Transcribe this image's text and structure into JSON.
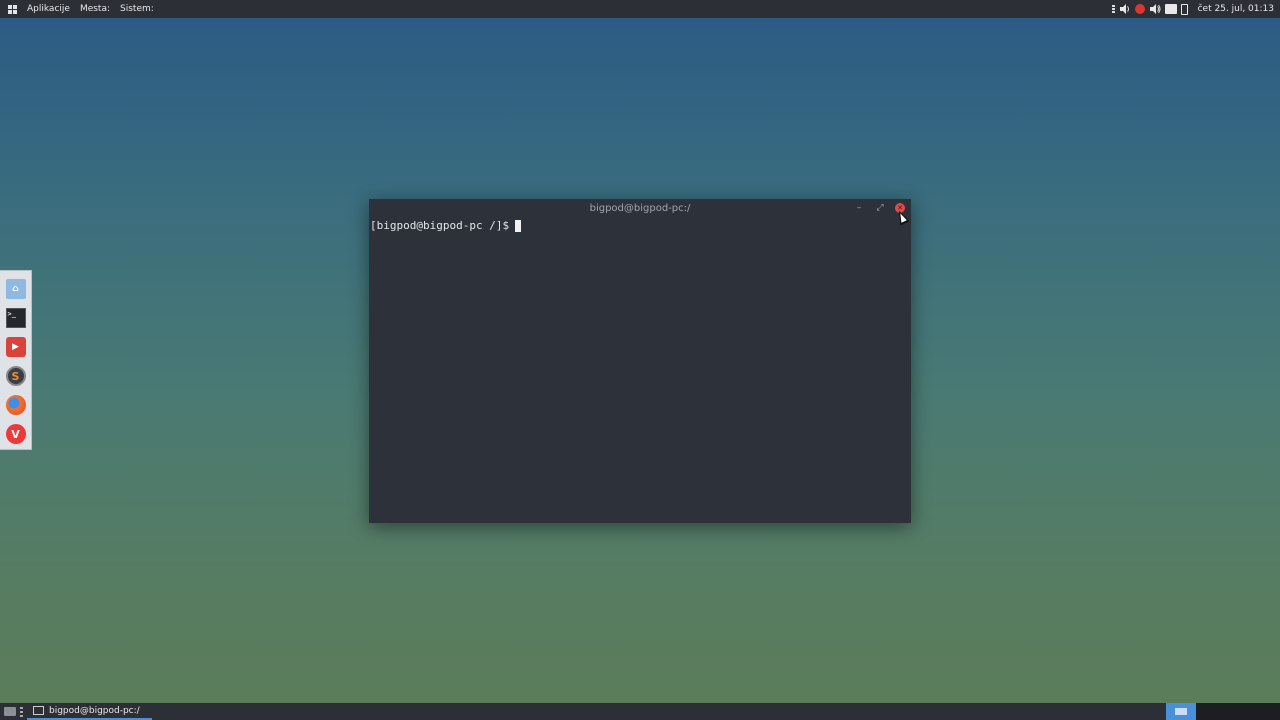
{
  "top_panel": {
    "menus": [
      "Aplikacije",
      "Mesta:",
      "Sistem:"
    ],
    "clock": "čet 25. jul, 01:13",
    "tray_icons": [
      "volume-icon",
      "bug-icon",
      "volume-icon",
      "network-icon",
      "battery-icon"
    ]
  },
  "dock": {
    "items": [
      {
        "name": "home-folder-icon",
        "glyph": "⌂"
      },
      {
        "name": "terminal-icon",
        "glyph": ">_"
      },
      {
        "name": "screen-recorder-icon",
        "glyph": "▶"
      },
      {
        "name": "s-app-icon",
        "glyph": "S"
      },
      {
        "name": "firefox-icon",
        "glyph": ""
      },
      {
        "name": "vivaldi-icon",
        "glyph": "V"
      }
    ]
  },
  "terminal": {
    "title": "bigpod@bigpod-pc:/",
    "minimize_glyph": "–",
    "maximize_glyph": "⤢",
    "close_glyph": "✕",
    "prompt": "[bigpod@bigpod-pc /]$"
  },
  "taskbar": {
    "task_label": "bigpod@bigpod-pc:/"
  },
  "colors": {
    "panel": "#2c2f35",
    "terminal_bg": "#2d3139",
    "accent": "#4a90d9",
    "close": "#e04a4a"
  }
}
